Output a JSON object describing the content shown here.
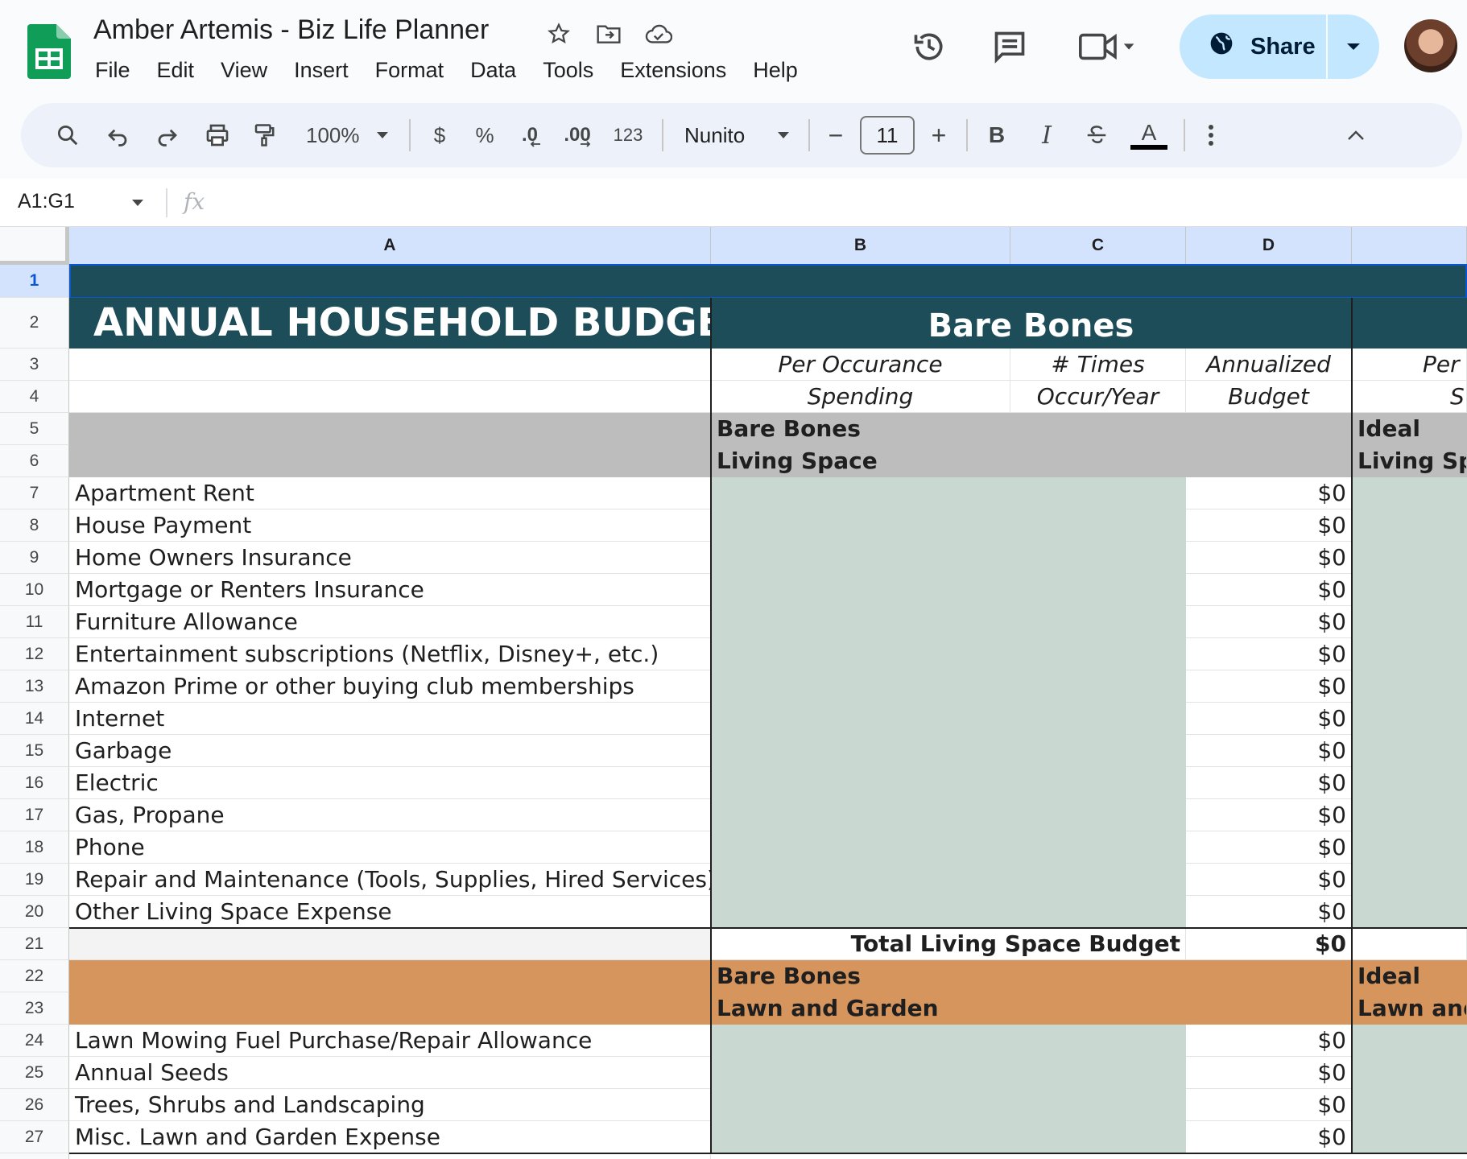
{
  "app": {
    "doc_title": "Amber Artemis - Biz Life Planner",
    "menu": [
      "File",
      "Edit",
      "View",
      "Insert",
      "Format",
      "Data",
      "Tools",
      "Extensions",
      "Help"
    ],
    "share_label": "Share",
    "icons": {
      "logo": "google-sheets-logo-icon",
      "star": "star-icon",
      "move": "move-to-folder-icon",
      "cloud": "cloud-saved-icon",
      "history": "version-history-icon",
      "comments": "comments-icon",
      "meet": "video-call-icon",
      "globe": "globe-icon",
      "avatar": "user-avatar"
    }
  },
  "toolbar": {
    "zoom": "100%",
    "currency": "$",
    "percent": "%",
    "dec_decrease": ".0",
    "dec_increase": ".00",
    "number_format": "123",
    "font": "Nunito",
    "font_size": "11",
    "minus": "−",
    "plus": "+",
    "bold": "B",
    "italic": "I",
    "text_color": "A"
  },
  "formula_bar": {
    "name_box": "A1:G1",
    "fx": "fx",
    "value": ""
  },
  "columns": [
    "A",
    "B",
    "C",
    "D"
  ],
  "sheet": {
    "title": "ANNUAL HOUSEHOLD BUDGET",
    "bare_bones_header": "Bare Bones",
    "sub_header_b": [
      "Per Occurance",
      "Spending"
    ],
    "sub_header_c": [
      "# Times",
      "Occur/Year"
    ],
    "sub_header_d": [
      "Annualized",
      "Budget"
    ],
    "sub_header_e": [
      "Per",
      "S"
    ],
    "living_space": {
      "group_label": "Bare Bones",
      "section_label": "Living Space",
      "ideal_label": "Ideal",
      "ideal_section": "Living Spa",
      "items": [
        {
          "name": "Apartment Rent",
          "budget": "$0"
        },
        {
          "name": "House Payment",
          "budget": "$0"
        },
        {
          "name": "Home Owners Insurance",
          "budget": "$0"
        },
        {
          "name": "Mortgage or Renters Insurance",
          "budget": "$0"
        },
        {
          "name": "Furniture Allowance",
          "budget": "$0"
        },
        {
          "name": "Entertainment subscriptions (Netflix, Disney+, etc.)",
          "budget": "$0"
        },
        {
          "name": "Amazon Prime or other buying club memberships",
          "budget": "$0"
        },
        {
          "name": "Internet",
          "budget": "$0"
        },
        {
          "name": "Garbage",
          "budget": "$0"
        },
        {
          "name": "Electric",
          "budget": "$0"
        },
        {
          "name": "Gas, Propane",
          "budget": "$0"
        },
        {
          "name": "Phone",
          "budget": "$0"
        },
        {
          "name": "Repair and Maintenance (Tools, Supplies, Hired Services)",
          "budget": "$0"
        },
        {
          "name": "Other Living Space Expense",
          "budget": "$0"
        }
      ],
      "total_label": "Total Living Space Budget",
      "total_value": "$0"
    },
    "lawn_garden": {
      "group_label": "Bare Bones",
      "section_label": "Lawn and Garden",
      "ideal_label": "Ideal",
      "ideal_section": "Lawn and",
      "items": [
        {
          "name": "Lawn Mowing Fuel Purchase/Repair Allowance",
          "budget": "$0"
        },
        {
          "name": "Annual Seeds",
          "budget": "$0"
        },
        {
          "name": "Trees, Shrubs and Landscaping",
          "budget": "$0"
        },
        {
          "name": "Misc. Lawn and Garden Expense",
          "budget": "$0"
        }
      ]
    }
  },
  "colors": {
    "teal_header": "#1e4d5a",
    "gray_section": "#bdbdbd",
    "orange_section": "#d6955c",
    "input_cell": "#c9d9d1",
    "selection": "#d3e3fd",
    "share_button": "#c2e7ff"
  }
}
